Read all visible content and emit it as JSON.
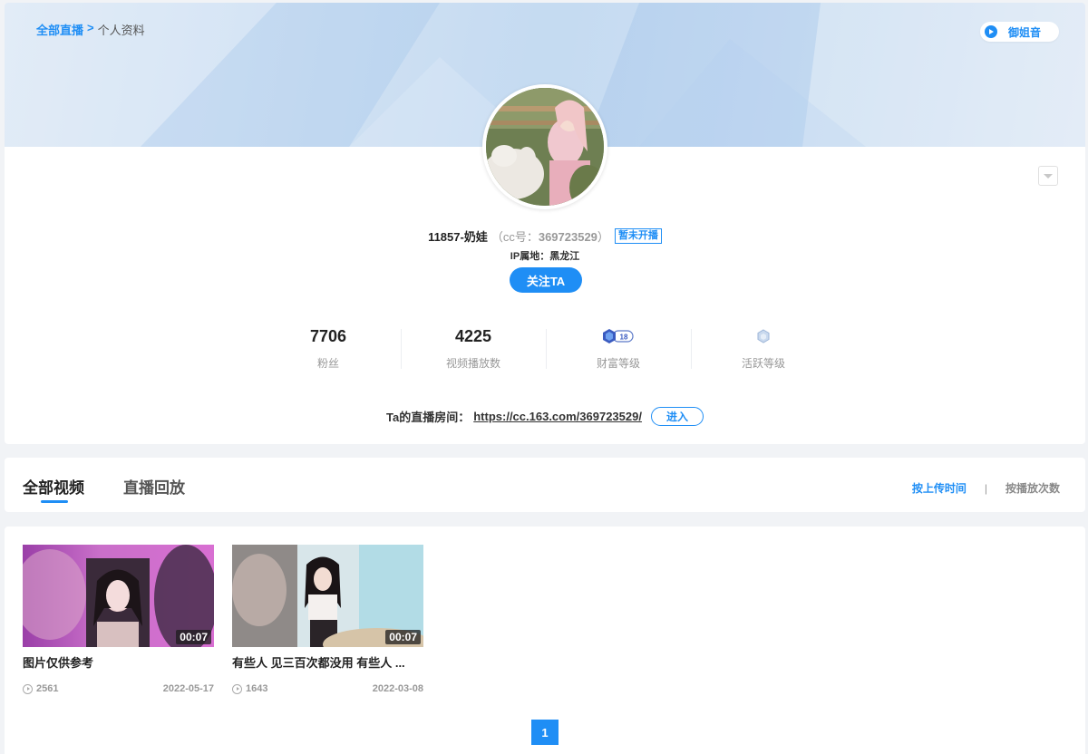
{
  "breadcrumb": {
    "root": "全部直播",
    "separator": ">",
    "current": "个人资料"
  },
  "voice": {
    "label": "御姐音",
    "icon": "play-icon"
  },
  "profile": {
    "name": "11857-奶娃",
    "cc_prefix": "（cc号：",
    "cc_number": "369723529",
    "cc_suffix": "）",
    "live_status": "暂未开播",
    "ip_location": "IP属地：黑龙江",
    "follow_label": "关注TA"
  },
  "stats": [
    {
      "value": "7706",
      "label": "粉丝"
    },
    {
      "value": "4225",
      "label": "视频播放数"
    },
    {
      "value": "",
      "label": "财富等级",
      "badge": "18"
    },
    {
      "value": "",
      "label": "活跃等级",
      "badge": ""
    }
  ],
  "room": {
    "prefix": "Ta的直播房间：",
    "url": "https://cc.163.com/369723529/",
    "enter_label": "进入"
  },
  "tabs": [
    {
      "label": "全部视频",
      "active": true
    },
    {
      "label": "直播回放",
      "active": false
    }
  ],
  "sort": {
    "by_time": "按上传时间",
    "separator": "|",
    "by_plays": "按播放次数"
  },
  "videos": [
    {
      "title": "图片仅供参考",
      "duration": "00:07",
      "plays": "2561",
      "date": "2022-05-17"
    },
    {
      "title": "有些人 见三百次都没用 有些人 ...",
      "duration": "00:07",
      "plays": "1643",
      "date": "2022-03-08"
    }
  ],
  "pagination": {
    "current": "1"
  },
  "colors": {
    "accent": "#1f8ef5",
    "page_bg": "#f1f3f6",
    "card_bg": "#ffffff"
  }
}
